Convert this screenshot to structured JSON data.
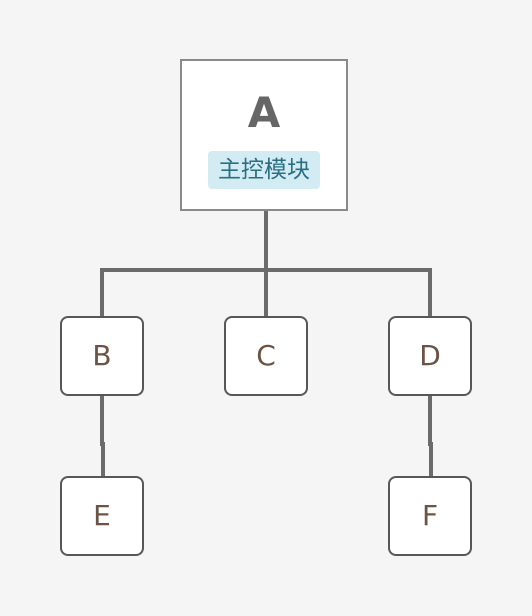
{
  "diagram": {
    "root": {
      "title": "A",
      "tag": "主控模块"
    },
    "nodes": {
      "b": "B",
      "c": "C",
      "d": "D",
      "e": "E",
      "f": "F"
    },
    "colors": {
      "background": "#f5f5f5",
      "node_fill": "#ffffff",
      "root_border": "#8a8a8a",
      "node_border": "#575757",
      "connector": "#6b6b6b",
      "tag_fill": "#d3ecf4",
      "tag_text": "#2a6f82",
      "node_text": "#6b5444"
    }
  }
}
